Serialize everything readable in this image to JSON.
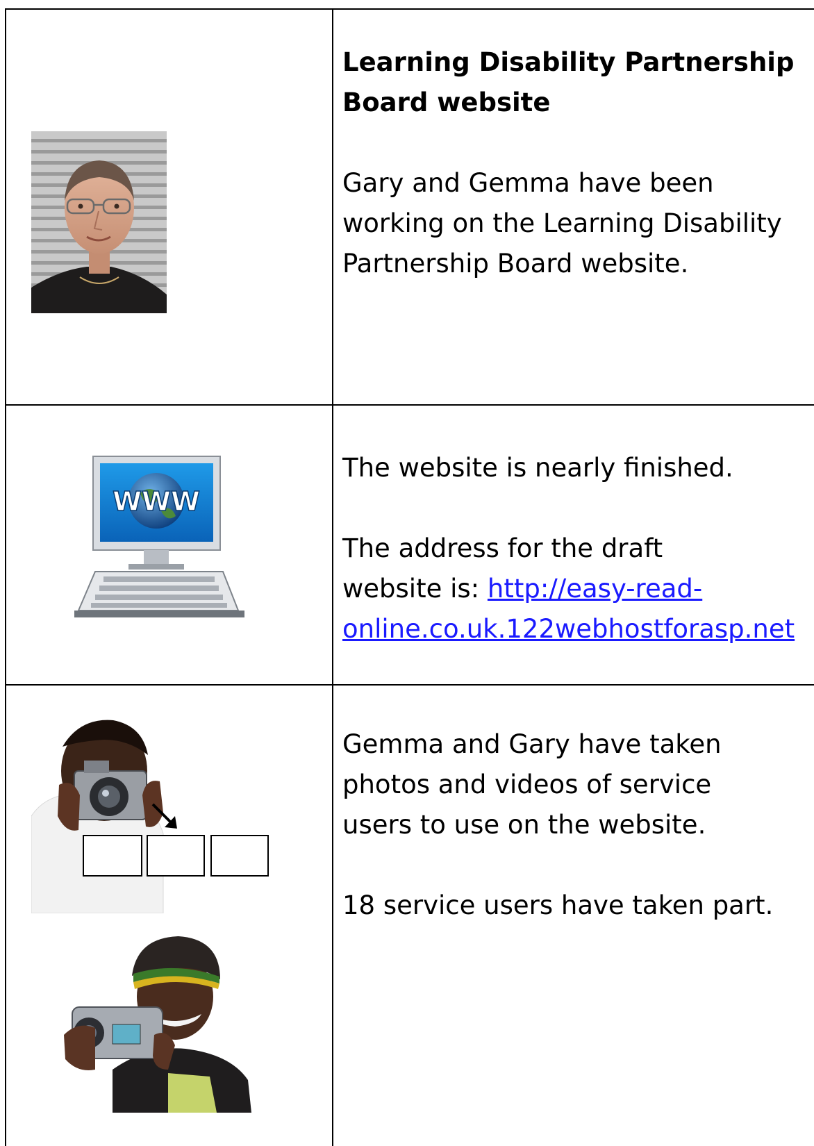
{
  "row1": {
    "heading_line1": "Learning Disability Partnership",
    "heading_line2": "Board website",
    "body_line1": "Gary and Gemma have been",
    "body_line2": "working on the Learning Disability",
    "body_line3": "Partnership Board website."
  },
  "row2": {
    "p1": "The website is nearly finished.",
    "p2_line1": "The address for the draft",
    "p2_line2_prefix": "website is: ",
    "link_part1": "http://easy-read-",
    "link_part2": "online.co.uk.122webhostforasp.net",
    "icon_label": "WWW"
  },
  "row3": {
    "p1_line1": "Gemma and Gary have taken",
    "p1_line2": "photos and videos of service",
    "p1_line3": "users to use on the website.",
    "p2": "18 service users have taken part."
  },
  "icons": [
    "portrait-photo",
    "computer-www-icon",
    "camera-photographer-icon",
    "video-camera-icon"
  ]
}
